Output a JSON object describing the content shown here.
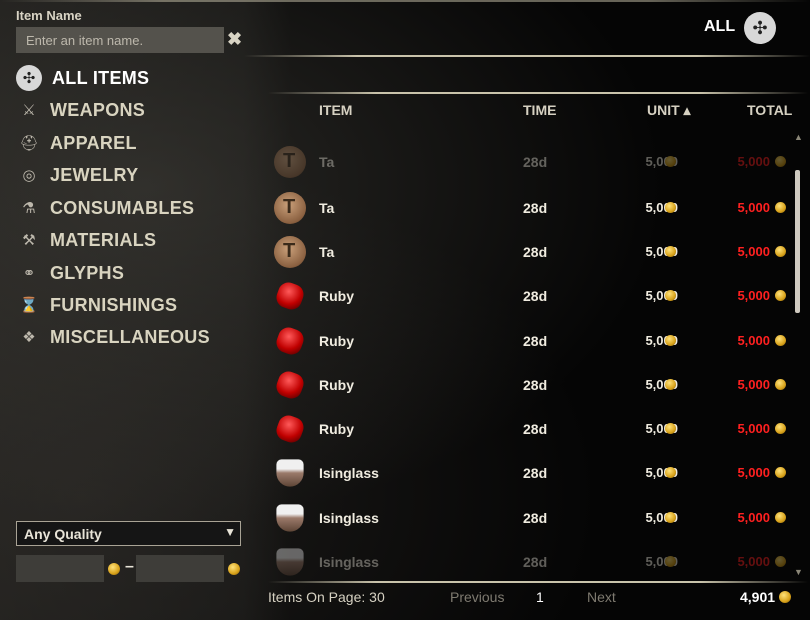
{
  "search": {
    "label": "Item Name",
    "placeholder": "Enter an item name.",
    "clear_symbol": "✖"
  },
  "categories": [
    {
      "label": "ALL ITEMS",
      "icon": "all-items-icon",
      "active": true
    },
    {
      "label": "WEAPONS",
      "icon": "weapons-icon"
    },
    {
      "label": "APPAREL",
      "icon": "apparel-icon"
    },
    {
      "label": "JEWELRY",
      "icon": "jewelry-icon"
    },
    {
      "label": "CONSUMABLES",
      "icon": "consumables-icon"
    },
    {
      "label": "MATERIALS",
      "icon": "materials-icon"
    },
    {
      "label": "GLYPHS",
      "icon": "glyphs-icon"
    },
    {
      "label": "FURNISHINGS",
      "icon": "furnishings-icon"
    },
    {
      "label": "MISCELLANEOUS",
      "icon": "miscellaneous-icon"
    }
  ],
  "filter": {
    "all_label": "ALL",
    "quality": "Any Quality",
    "price_dash": "–"
  },
  "table": {
    "headers": {
      "item": "ITEM",
      "time": "TIME",
      "unit": "UNIT ▴",
      "total": "TOTAL"
    },
    "rows": [
      {
        "name": "Ta",
        "icon": "ta",
        "time": "28d",
        "unit": "5,000",
        "total": "5,000"
      },
      {
        "name": "Ta",
        "icon": "ta",
        "time": "28d",
        "unit": "5,000",
        "total": "5,000"
      },
      {
        "name": "Ta",
        "icon": "ta",
        "time": "28d",
        "unit": "5,000",
        "total": "5,000"
      },
      {
        "name": "Ruby",
        "icon": "ruby",
        "time": "28d",
        "unit": "5,000",
        "total": "5,000"
      },
      {
        "name": "Ruby",
        "icon": "ruby",
        "time": "28d",
        "unit": "5,000",
        "total": "5,000"
      },
      {
        "name": "Ruby",
        "icon": "ruby",
        "time": "28d",
        "unit": "5,000",
        "total": "5,000"
      },
      {
        "name": "Ruby",
        "icon": "ruby",
        "time": "28d",
        "unit": "5,000",
        "total": "5,000"
      },
      {
        "name": "Isinglass",
        "icon": "isinglass",
        "time": "28d",
        "unit": "5,000",
        "total": "5,000"
      },
      {
        "name": "Isinglass",
        "icon": "isinglass",
        "time": "28d",
        "unit": "5,000",
        "total": "5,000"
      },
      {
        "name": "Isinglass",
        "icon": "isinglass",
        "time": "28d",
        "unit": "5,000",
        "total": "5,000"
      }
    ]
  },
  "footer": {
    "items_on_page": "Items On Page: 30",
    "previous": "Previous",
    "page": "1",
    "next": "Next",
    "gold": "4,901"
  },
  "colors": {
    "total_price": "#ff2020",
    "gold": "#e0a820",
    "panel": "#050505"
  }
}
